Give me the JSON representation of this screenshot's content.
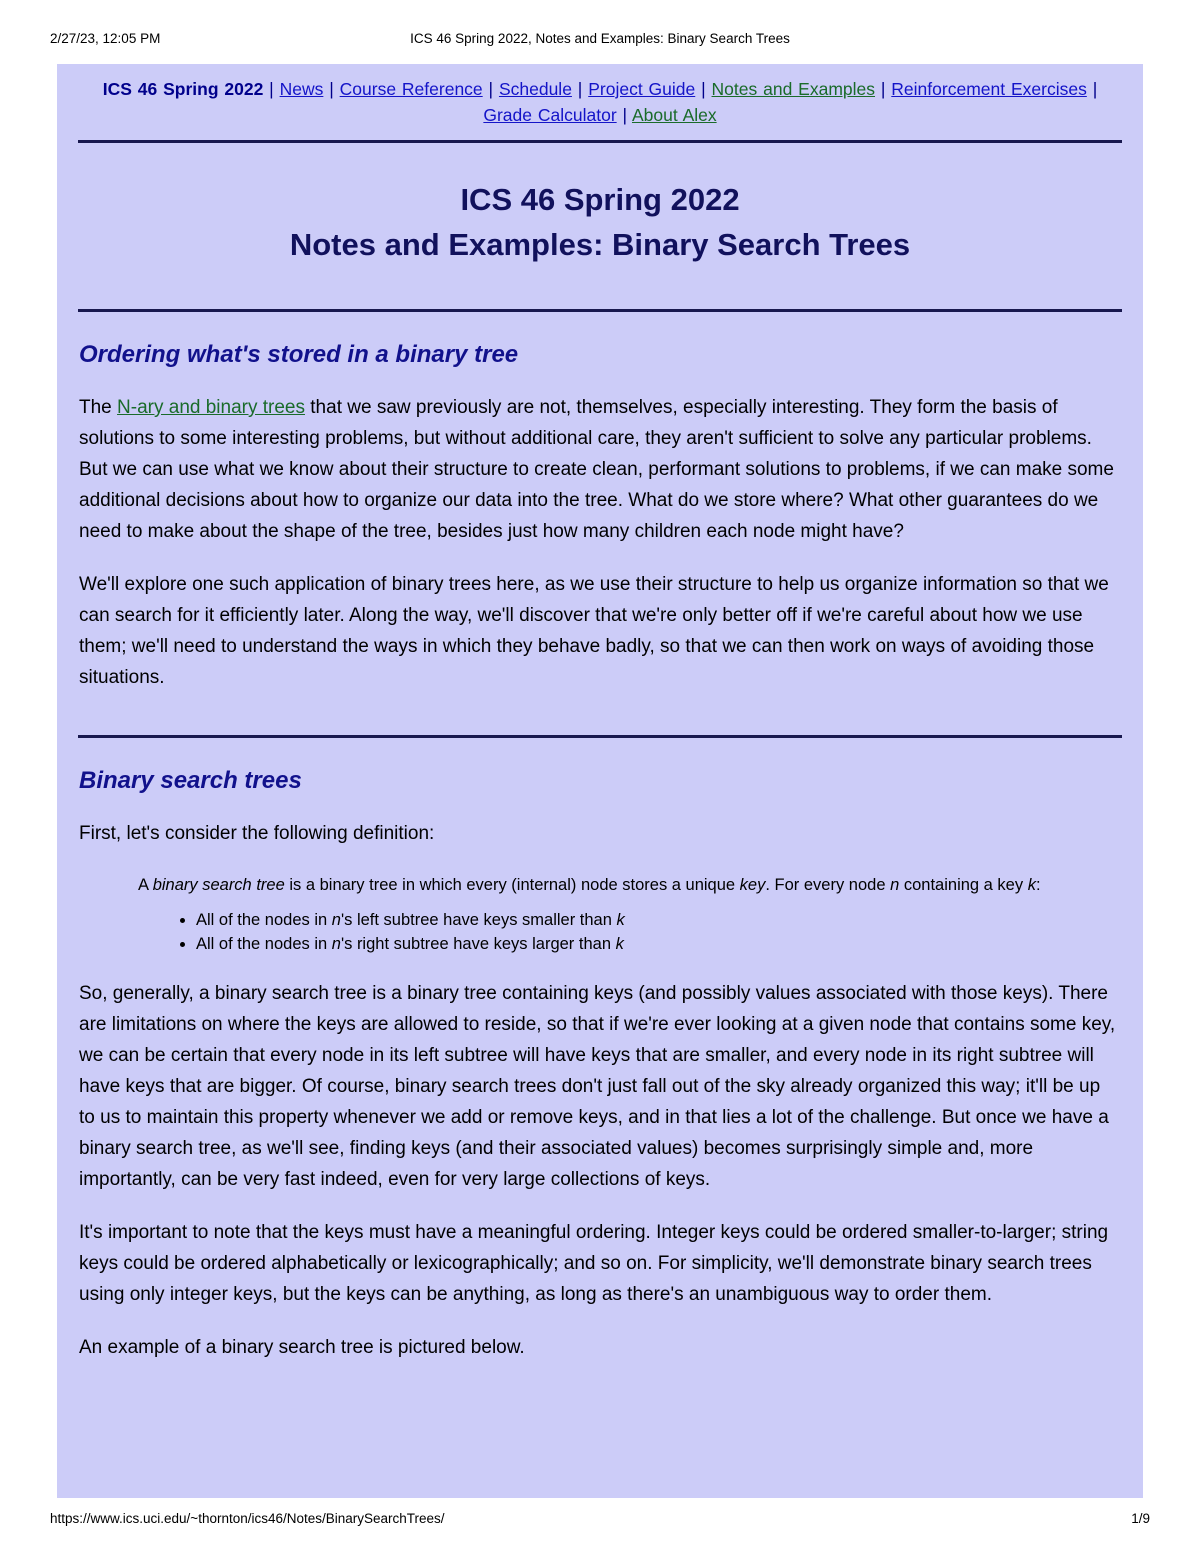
{
  "print_header": {
    "timestamp": "2/27/23, 12:05 PM",
    "doc_title": "ICS 46 Spring 2022, Notes and Examples: Binary Search Trees"
  },
  "print_footer": {
    "url": "https://www.ics.uci.edu/~thornton/ics46/Notes/BinarySearchTrees/",
    "page_number": "1/9"
  },
  "nav": {
    "course_label": "ICS 46 Spring 2022",
    "separator": "|",
    "items": [
      {
        "label": "News",
        "state": "unvisited"
      },
      {
        "label": "Course Reference",
        "state": "unvisited"
      },
      {
        "label": "Schedule",
        "state": "unvisited"
      },
      {
        "label": "Project Guide",
        "state": "unvisited"
      },
      {
        "label": "Notes and Examples",
        "state": "visited"
      },
      {
        "label": "Reinforcement Exercises",
        "state": "unvisited"
      },
      {
        "label": "Grade Calculator",
        "state": "unvisited"
      },
      {
        "label": "About Alex",
        "state": "visited"
      }
    ]
  },
  "title": {
    "line1": "ICS 46 Spring 2022",
    "line2": "Notes and Examples: Binary Search Trees"
  },
  "sections": [
    {
      "heading": "Ordering what's stored in a binary tree",
      "para1_before_link": "The ",
      "para1_link": "N-ary and binary trees",
      "para1_after_link": " that we saw previously are not, themselves, especially interesting. They form the basis of solutions to some interesting problems, but without additional care, they aren't sufficient to solve any particular problems. But we can use what we know about their structure to create clean, performant solutions to problems, if we can make some additional decisions about how to organize our data into the tree. What do we store where? What other guarantees do we need to make about the shape of the tree, besides just how many children each node might have?",
      "para2": "We'll explore one such application of binary trees here, as we use their structure to help us organize information so that we can search for it efficiently later. Along the way, we'll discover that we're only better off if we're careful about how we use them; we'll need to understand the ways in which they behave badly, so that we can then work on ways of avoiding those situations."
    },
    {
      "heading": "Binary search trees",
      "intro": "First, let's consider the following definition:",
      "definition": {
        "seg1": "A ",
        "em1": "binary search tree",
        "seg2": " is a binary tree in which every (internal) node stores a unique ",
        "em2": "key",
        "seg3": ". For every node ",
        "em3": "n",
        "seg4": " containing a key ",
        "em4": "k",
        "seg5": ":"
      },
      "bullets": [
        {
          "seg1": "All of the nodes in ",
          "em1": "n",
          "seg2": "'s left subtree have keys smaller than ",
          "em2": "k"
        },
        {
          "seg1": "All of the nodes in ",
          "em1": "n",
          "seg2": "'s right subtree have keys larger than ",
          "em2": "k"
        }
      ],
      "para_after_list": "So, generally, a binary search tree is a binary tree containing keys (and possibly values associated with those keys). There are limitations on where the keys are allowed to reside, so that if we're ever looking at a given node that contains some key, we can be certain that every node in its left subtree will have keys that are smaller, and every node in its right subtree will have keys that are bigger. Of course, binary search trees don't just fall out of the sky already organized this way; it'll be up to us to maintain this property whenever we add or remove keys, and in that lies a lot of the challenge. But once we have a binary search tree, as we'll see, finding keys (and their associated values) becomes surprisingly simple and, more importantly, can be very fast indeed, even for very large collections of keys.",
      "para_ordering": "It's important to note that the keys must have a meaningful ordering. Integer keys could be ordered smaller-to-larger; string keys could be ordered alphabetically or lexicographically; and so on. For simplicity, we'll demonstrate binary search trees using only integer keys, but the keys can be anything, as long as there's an unambiguous way to order them.",
      "para_example": "An example of a binary search tree is pictured below."
    }
  ],
  "colors": {
    "page_background": "#ccccf8",
    "heading_navy": "#11115c",
    "section_heading": "#11118c",
    "link_unvisited": "#1414c8",
    "link_visited": "#1a6b2a",
    "rule": "#18184f",
    "body_text": "#000000"
  }
}
